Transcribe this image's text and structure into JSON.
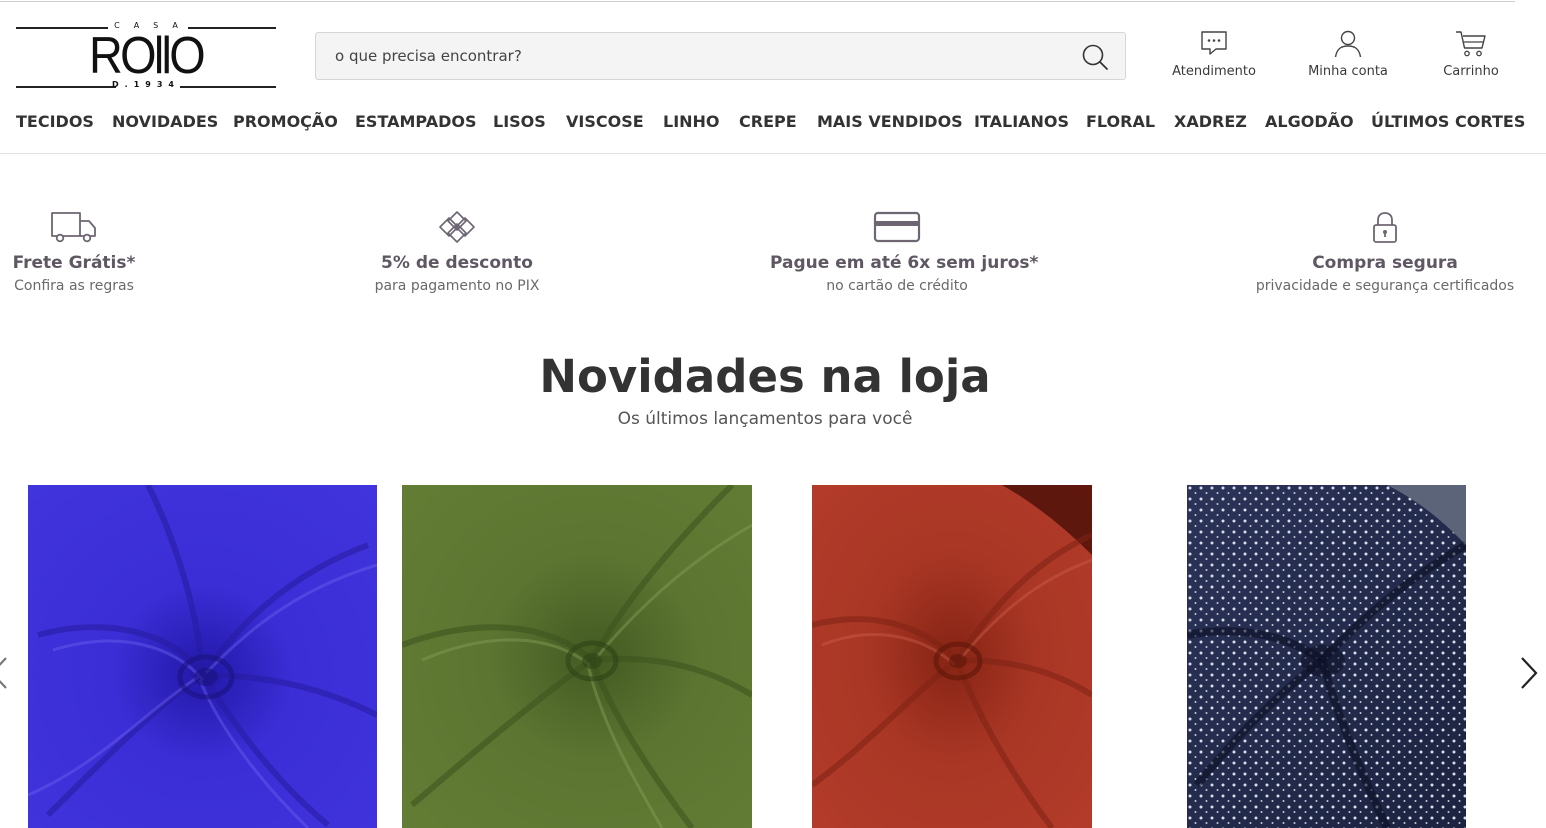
{
  "logo": {
    "top_text": "CASA",
    "word": "ROllO",
    "bottom_text": "D.1934"
  },
  "search": {
    "placeholder": "o que precisa encontrar?",
    "value": ""
  },
  "header_actions": [
    {
      "label": "Atendimento",
      "icon": "chat-icon"
    },
    {
      "label": "Minha conta",
      "icon": "user-icon"
    },
    {
      "label": "Carrinho",
      "icon": "cart-icon"
    }
  ],
  "nav": [
    "TECIDOS",
    "NOVIDADES",
    "PROMOÇÃO",
    "ESTAMPADOS",
    "LISOS",
    "VISCOSE",
    "LINHO",
    "CREPE",
    "MAIS VENDIDOS",
    "ITALIANOS",
    "FLORAL",
    "XADREZ",
    "ALGODÃO",
    "ÚLTIMOS CORTES"
  ],
  "benefits": [
    {
      "title": "Frete Grátis*",
      "subtitle": "Confira as regras",
      "icon": "truck-icon"
    },
    {
      "title": "5% de desconto",
      "subtitle": "para pagamento no PIX",
      "icon": "pix-icon"
    },
    {
      "title": "Pague em até 6x sem juros*",
      "subtitle": "no cartão de crédito",
      "icon": "credit-card-icon"
    },
    {
      "title": "Compra segura",
      "subtitle": "privacidade e segurança certificados",
      "icon": "lock-icon"
    }
  ],
  "section": {
    "title": "Novidades na loja",
    "subtitle": "Os últimos lançamentos para você"
  },
  "products": [
    {
      "name": "blue-fabric",
      "color": "#3d2fd4"
    },
    {
      "name": "green-fabric",
      "color": "#5d7632"
    },
    {
      "name": "red-fabric",
      "color": "#b0392a"
    },
    {
      "name": "navy-dotted-fabric",
      "color": "#1f2648"
    }
  ],
  "colors": {
    "text": "#333333",
    "benefit_title": "#5f5863",
    "icon": "#6e6672"
  }
}
